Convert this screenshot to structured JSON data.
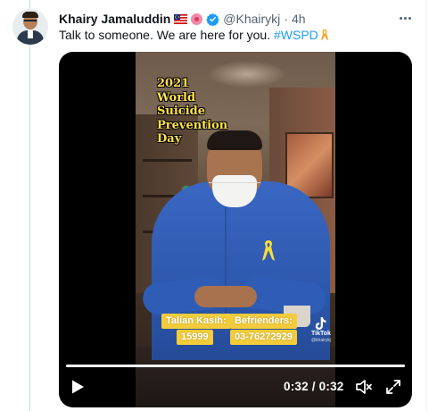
{
  "tweet": {
    "author_name": "Khairy Jamaluddin",
    "handle": "@Khairykj",
    "separator": "·",
    "time_ago": "4h",
    "author_icons": [
      "malaysia-flag-emoji",
      "hibiscus-emoji",
      "verified-badge-icon"
    ],
    "text": "Talk to someone. We are here for you. ",
    "hashtag": "#WSPD",
    "trailing_emoji": "ribbon-emoji"
  },
  "video": {
    "overlay_title": [
      "2021",
      "World",
      "Suicide",
      "Prevention",
      "Day"
    ],
    "info": {
      "talian_kasih_label": "Talian Kasih:",
      "talian_kasih_number": "15999",
      "befrienders_label": "Befrienders:",
      "befrienders_number": "03-76272929"
    },
    "watermark": {
      "brand": "TikTok",
      "username": "@khairykj"
    },
    "player": {
      "time_display": "0:32 / 0:32",
      "progress": 1.0
    }
  },
  "colors": {
    "accent": "#1d9bf0",
    "secondary_text": "#536471",
    "overlay_yellow": "#ffe24d",
    "info_box": "#f2cc3a"
  }
}
